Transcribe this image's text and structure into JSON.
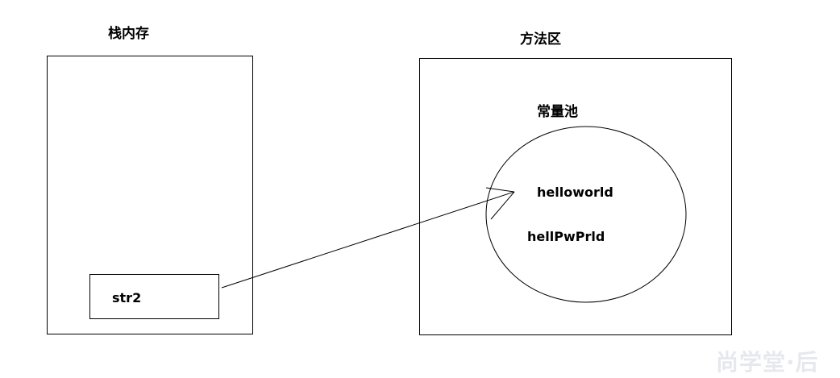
{
  "stack": {
    "title": "栈内存",
    "variable": "str2"
  },
  "method_area": {
    "title": "方法区",
    "constant_pool": {
      "title": "常量池",
      "items": [
        "helloworld",
        "hellPwPrld"
      ]
    }
  },
  "reference": {
    "from": "str2",
    "to": "helloworld"
  },
  "watermark": "尚学堂·后"
}
